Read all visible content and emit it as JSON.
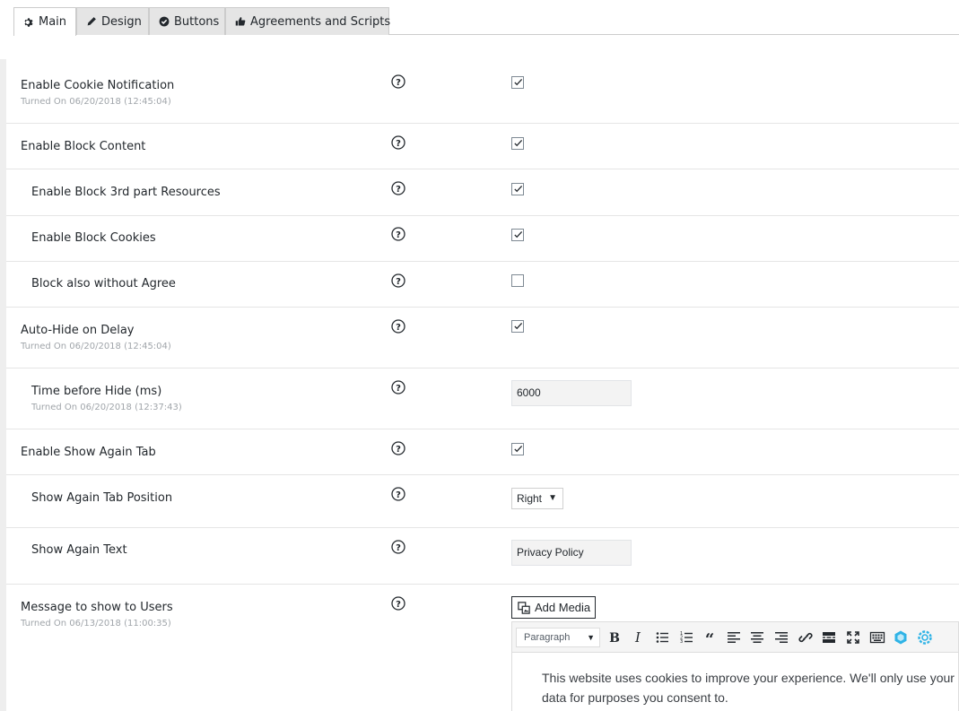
{
  "tabs": [
    {
      "label": "Main",
      "icon": "gear-icon",
      "active": true
    },
    {
      "label": "Design",
      "icon": "pencil-icon",
      "active": false
    },
    {
      "label": "Buttons",
      "icon": "check-circle-icon",
      "active": false
    },
    {
      "label": "Agreements and Scripts",
      "icon": "thumbs-up-icon",
      "active": false
    }
  ],
  "settings": {
    "enable_cookie_notification": {
      "label": "Enable Cookie Notification",
      "status": "Turned On 06/20/2018 (12:45:04)",
      "checked": true
    },
    "enable_block_content": {
      "label": "Enable Block Content",
      "checked": true
    },
    "enable_block_3rd_party": {
      "label": "Enable Block 3rd part Resources",
      "checked": true
    },
    "enable_block_cookies": {
      "label": "Enable Block Cookies",
      "checked": true
    },
    "block_without_agree": {
      "label": "Block also without Agree",
      "checked": false
    },
    "auto_hide_on_delay": {
      "label": "Auto-Hide on Delay",
      "status": "Turned On 06/20/2018 (12:45:04)",
      "checked": true
    },
    "time_before_hide": {
      "label": "Time before Hide (ms)",
      "status": "Turned On 06/20/2018 (12:37:43)",
      "value": "6000"
    },
    "enable_show_again_tab": {
      "label": "Enable Show Again Tab",
      "checked": true
    },
    "show_again_tab_position": {
      "label": "Show Again Tab Position",
      "value": "Right"
    },
    "show_again_text": {
      "label": "Show Again Text",
      "value": "Privacy Policy"
    },
    "message_to_show": {
      "label": "Message to show to Users",
      "status": "Turned On 06/13/2018 (11:00:35)"
    }
  },
  "editor": {
    "add_media_label": "Add Media",
    "format_select": "Paragraph",
    "toolbar_buttons": [
      "bold-icon",
      "italic-icon",
      "bullet-list-icon",
      "numbered-list-icon",
      "blockquote-icon",
      "align-left-icon",
      "align-center-icon",
      "align-right-icon",
      "link-icon",
      "read-more-icon",
      "fullscreen-icon",
      "toolbar-toggle-icon",
      "plugin-icon-1",
      "plugin-icon-2"
    ],
    "content": "This website uses cookies to improve your experience. We'll only use your data for purposes you consent to."
  },
  "colors": {
    "tab_inactive_bg": "#e5e5e5",
    "row_border": "#e5e5e5",
    "status_text": "#a0a5aa",
    "plugin_icon": "#2fb3e6"
  }
}
